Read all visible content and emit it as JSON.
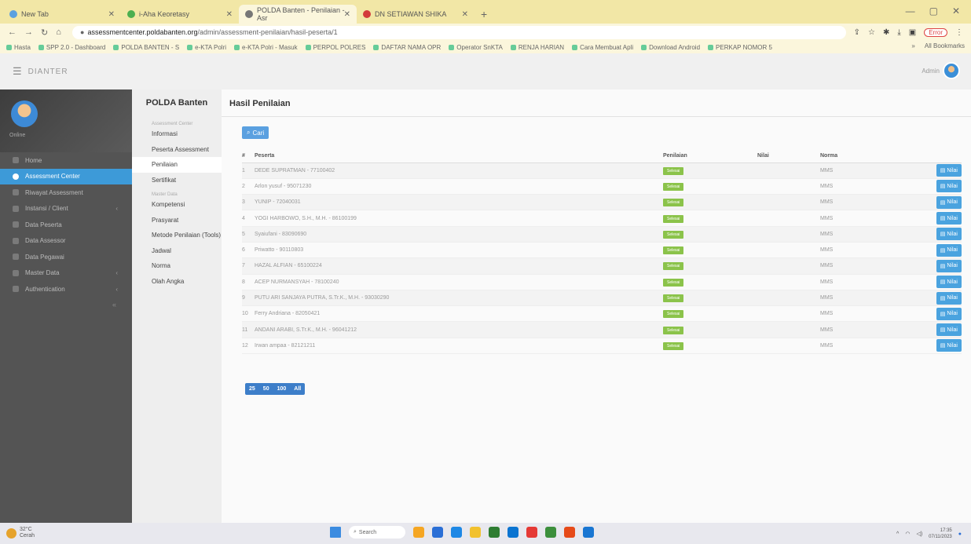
{
  "browser": {
    "tabs": [
      {
        "title": "New Tab",
        "color": "#5aa0e0"
      },
      {
        "title": "i-Aha Keoretasy",
        "color": "#4caf50"
      },
      {
        "title": "POLDA Banten - Penilaian - Asr",
        "color": "#777777",
        "active": true
      },
      {
        "title": "DN SETIAWAN SHIKA",
        "color": "#d33b3b"
      }
    ],
    "url_host": "assessmentcenter.poldabanten.org",
    "url_path": "/admin/assessment-penilaian/hasil-peserta/1",
    "profile_label": "Error",
    "bookmarks": [
      "Hasta",
      "SPP 2.0 - Dashboard",
      "POLDA BANTEN - S",
      "e-KTA Polri",
      "e-KTA Polri - Masuk",
      "PERPOL POLRES",
      "DAFTAR NAMA OPR",
      "Operator SnKTA",
      "RENJA HARIAN",
      "Cara Membuat Apli",
      "Download Android",
      "PERKAP NOMOR 5"
    ],
    "all_bookmarks": "All Bookmarks"
  },
  "topbar": {
    "brand": "DIANTER",
    "admin_label": "Admin"
  },
  "sidebar": {
    "status": "Online",
    "items": [
      {
        "label": "Home"
      },
      {
        "label": "Assessment Center",
        "active": true
      },
      {
        "label": "Riwayat Assessment"
      },
      {
        "label": "Instansi / Client",
        "arrow": true
      },
      {
        "label": "Data Peserta"
      },
      {
        "label": "Data Assessor"
      },
      {
        "label": "Data Pegawai"
      },
      {
        "label": "Master Data",
        "arrow": true
      },
      {
        "label": "Authentication",
        "arrow": true
      }
    ],
    "collapse": "«"
  },
  "subnav": {
    "title": "POLDA Banten",
    "group1": "Assessment Center",
    "items1": [
      {
        "label": "Informasi"
      },
      {
        "label": "Peserta Assessment"
      },
      {
        "label": "Penilaian",
        "active": true
      },
      {
        "label": "Sertifikat"
      }
    ],
    "group2": "Master Data",
    "items2": [
      {
        "label": "Kompetensi"
      },
      {
        "label": "Prasyarat"
      },
      {
        "label": "Metode Penilaian (Tools)"
      },
      {
        "label": "Jadwal"
      },
      {
        "label": "Norma"
      },
      {
        "label": "Olah Angka"
      }
    ]
  },
  "main": {
    "title": "Hasil Penilaian",
    "search_button": "Cari",
    "columns": [
      "#",
      "Peserta",
      "Penilaian",
      "Nilai",
      "Norma",
      ""
    ],
    "rows": [
      {
        "no": "1",
        "peserta": "DEDE SUPRATMAN - 77100402",
        "status": "Selesai",
        "nilai": "",
        "norma": "MMS",
        "action": "Nilai"
      },
      {
        "no": "2",
        "peserta": "Arlon yusuf - 95071230",
        "status": "Selesai",
        "nilai": "",
        "norma": "MMS",
        "action": "Nilai"
      },
      {
        "no": "3",
        "peserta": "YUNIP - 72040031",
        "status": "Selesai",
        "nilai": "",
        "norma": "MMS",
        "action": "Nilai"
      },
      {
        "no": "4",
        "peserta": "YOGI HARBOWO, S.H., M.H. - 86100199",
        "status": "Selesai",
        "nilai": "",
        "norma": "MMS",
        "action": "Nilai"
      },
      {
        "no": "5",
        "peserta": "Syaiufani - 83090690",
        "status": "Selesai",
        "nilai": "",
        "norma": "MMS",
        "action": "Nilai"
      },
      {
        "no": "6",
        "peserta": "Priwatto - 90110803",
        "status": "Selesai",
        "nilai": "",
        "norma": "MMS",
        "action": "Nilai"
      },
      {
        "no": "7",
        "peserta": "HAZAL ALFIAN - 65100224",
        "status": "Selesai",
        "nilai": "",
        "norma": "MMS",
        "action": "Nilai"
      },
      {
        "no": "8",
        "peserta": "ACEP NURMANSYAH - 78100240",
        "status": "Selesai",
        "nilai": "",
        "norma": "MMS",
        "action": "Nilai"
      },
      {
        "no": "9",
        "peserta": "PUTU ARI SANJAYA PUTRA, S.Tr.K., M.H. - 93030290",
        "status": "Selesai",
        "nilai": "",
        "norma": "MMS",
        "action": "Nilai"
      },
      {
        "no": "10",
        "peserta": "Ferry Andriana - 82050421",
        "status": "Selesai",
        "nilai": "",
        "norma": "MMS",
        "action": "Nilai"
      },
      {
        "no": "11",
        "peserta": "ANDANI ARABI, S.Tr.K., M.H. - 96041212",
        "status": "Selesai",
        "nilai": "",
        "norma": "MMS",
        "action": "Nilai"
      },
      {
        "no": "12",
        "peserta": "Irwan ampaa - 82121211",
        "status": "Selesai",
        "nilai": "",
        "norma": "MMS",
        "action": "Nilai"
      }
    ],
    "pager": [
      "25",
      "50",
      "100",
      "All"
    ]
  },
  "taskbar": {
    "weather_temp": "32°C",
    "weather_desc": "Cerah",
    "search": "Search",
    "time": "17:35",
    "date": "07/11/2023",
    "app_colors": [
      "#f5a623",
      "#2b6fd6",
      "#1e88e5",
      "#f2c12e",
      "#2e7d32",
      "#0b74d1",
      "#e53935",
      "#3c8f3c",
      "#e64a19",
      "#1976d2"
    ]
  }
}
